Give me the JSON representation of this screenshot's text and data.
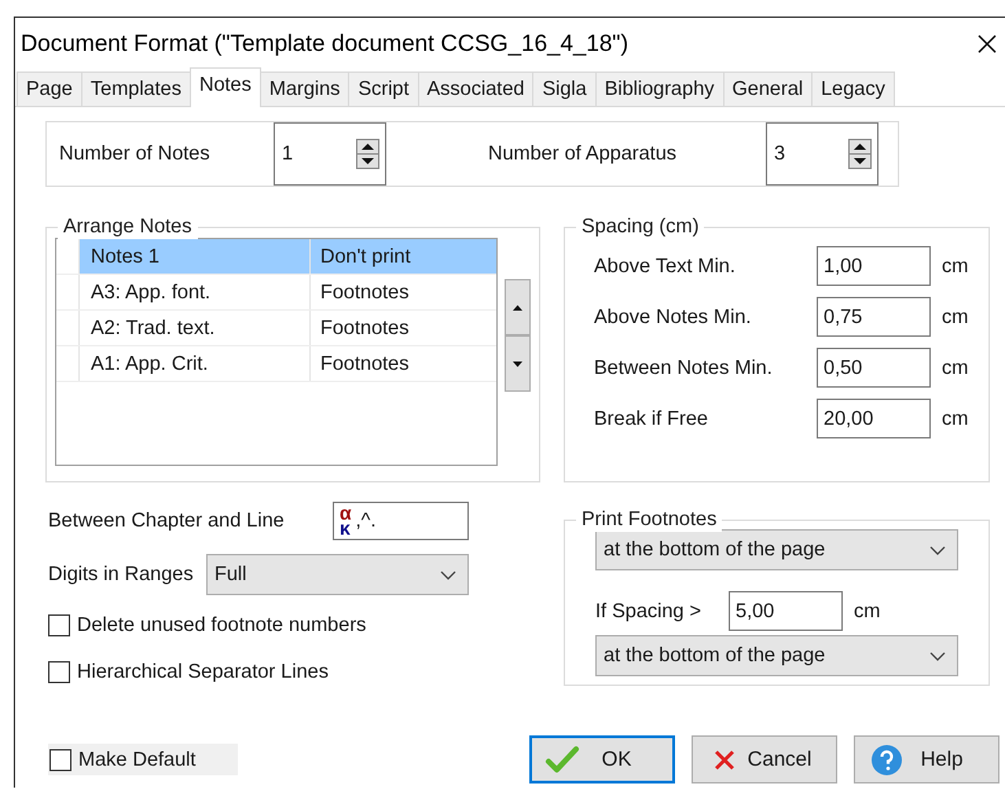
{
  "window": {
    "title": "Document Format (\"Template document CCSG_16_4_18\")"
  },
  "tabs": [
    {
      "label": "Page",
      "selected": false
    },
    {
      "label": "Templates",
      "selected": false
    },
    {
      "label": "Notes",
      "selected": true
    },
    {
      "label": "Margins",
      "selected": false
    },
    {
      "label": "Script",
      "selected": false
    },
    {
      "label": "Associated",
      "selected": false
    },
    {
      "label": "Sigla",
      "selected": false
    },
    {
      "label": "Bibliography",
      "selected": false
    },
    {
      "label": "General",
      "selected": false
    },
    {
      "label": "Legacy",
      "selected": false
    }
  ],
  "counts": [
    {
      "label": "Number of Notes",
      "value": "1"
    },
    {
      "label": "Number of Apparatus",
      "value": "3"
    }
  ],
  "arrange_notes": {
    "title": "Arrange Notes",
    "rows": [
      {
        "name": "Notes 1",
        "output": "Don't print",
        "selected": true
      },
      {
        "name": "A3: App. font.",
        "output": "Footnotes",
        "selected": false
      },
      {
        "name": "A2: Trad. text.",
        "output": "Footnotes",
        "selected": false
      },
      {
        "name": "A1: App. Crit.",
        "output": "Footnotes",
        "selected": false
      }
    ]
  },
  "spacing": {
    "title": "Spacing (cm)",
    "fields": [
      {
        "label": "Above Text Min.",
        "value": "1,00",
        "unit": "cm"
      },
      {
        "label": "Above Notes Min.",
        "value": "0,75",
        "unit": "cm"
      },
      {
        "label": "Between Notes Min.",
        "value": "0,50",
        "unit": "cm"
      },
      {
        "label": "Break if Free",
        "value": "20,00",
        "unit": "cm"
      }
    ]
  },
  "chapter_line": {
    "label": "Between Chapter and Line",
    "symbols": [
      {
        "text": "α",
        "color": "#a01010"
      },
      {
        "text": "κ",
        "color": "#10108c"
      }
    ],
    "value": ",^."
  },
  "digits_in_ranges": {
    "label": "Digits in Ranges",
    "value": "Full"
  },
  "options": [
    {
      "label": "Delete unused footnote numbers",
      "checked": false
    },
    {
      "label": "Hierarchical Separator Lines",
      "checked": false
    }
  ],
  "print_footnotes": {
    "title": "Print Footnotes",
    "position": "at the bottom of the page",
    "if_spacing_label": "If Spacing >",
    "if_spacing_value": "5,00",
    "if_spacing_unit": "cm",
    "alternate_position": "at the bottom of the page"
  },
  "make_default": {
    "label": "Make Default",
    "checked": false
  },
  "buttons": [
    {
      "label": "OK",
      "kind": "ok",
      "focused": true
    },
    {
      "label": "Cancel",
      "kind": "cancel",
      "focused": false
    },
    {
      "label": "Help",
      "kind": "help",
      "focused": false
    }
  ]
}
